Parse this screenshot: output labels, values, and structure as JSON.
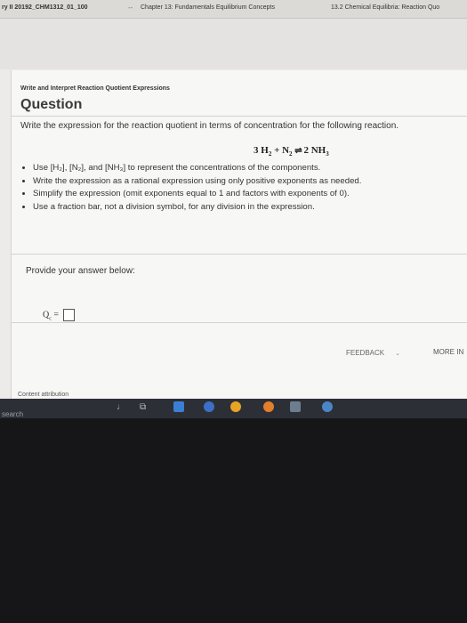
{
  "tabs": [
    {
      "label": "ry II 20192_CHM1312_01_100"
    },
    {
      "label": "Chapter 13: Fundamentals Equilibrium Concepts"
    },
    {
      "label": "13.2 Chemical Equilibria: Reaction Quo"
    }
  ],
  "tab_separator": "--",
  "breadcrumb": "Write and Interpret Reaction Quotient Expressions",
  "question_title": "Question",
  "prompt": "Write the expression for the reaction quotient in terms of concentration for the following reaction.",
  "equation": {
    "r1_coef": "3",
    "r1": "H",
    "r1_sub": "2",
    "plus": "+",
    "r2": "N",
    "r2_sub": "2",
    "arrow": "⇌",
    "p1_coef": "2",
    "p1": "NH",
    "p1_sub": "3"
  },
  "rules": [
    "Use [H₂], [N₂], and [NH₃] to represent the concentrations of the components.",
    "Write the expression as a rational expression using only positive exponents as needed.",
    "Simplify the expression (omit exponents equal to 1 and factors with exponents of 0).",
    "Use a fraction bar, not a division symbol, for any division in the expression."
  ],
  "answer_label": "Provide your answer below:",
  "answer": {
    "symbol": "Q",
    "sub": "c",
    "equals": "=",
    "value": ""
  },
  "feedback_label": "FEEDBACK",
  "more_info_label": "MORE IN",
  "content_attribution": "Content attribution",
  "taskbar": {
    "search_text": "search"
  },
  "colors": {
    "page_bg": "#f7f7f6",
    "taskbar": "#2c2f36"
  }
}
